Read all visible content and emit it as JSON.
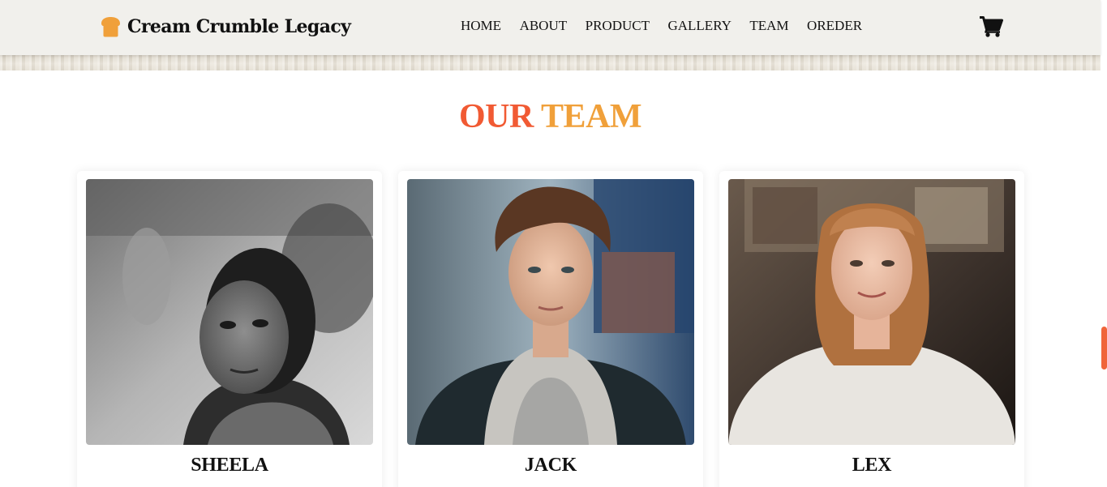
{
  "header": {
    "brand": "Cream Crumble Legacy",
    "brand_icon": "bread-icon",
    "nav": [
      "HOME",
      "ABOUT",
      "PRODUCT",
      "GALLERY",
      "TEAM",
      "OREDER"
    ],
    "cart_icon": "shopping-cart-icon"
  },
  "team": {
    "title_part1": "OUR",
    "title_part2": "TEAM",
    "members": [
      {
        "name": "SHEELA"
      },
      {
        "name": "JACK"
      },
      {
        "name": "LEX"
      }
    ]
  },
  "colors": {
    "accent_red": "#f15a33",
    "accent_orange": "#f0a03a",
    "nav_background": "#f1f0ec"
  }
}
